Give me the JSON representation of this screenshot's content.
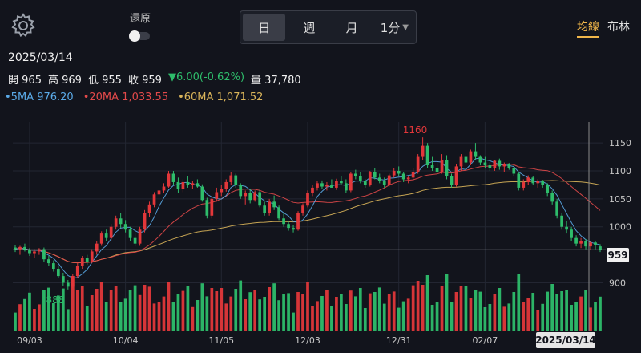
{
  "header": {
    "restore_label": "還原",
    "periods": [
      "日",
      "週",
      "月"
    ],
    "minute_label": "1分",
    "indicator_tabs": [
      "均線",
      "布林"
    ]
  },
  "quote": {
    "date": "2025/03/14",
    "open_label": "開",
    "open": "965",
    "high_label": "高",
    "high": "969",
    "low_label": "低",
    "low": "955",
    "close_label": "收",
    "close": "959",
    "change": "6.00(-0.62%)",
    "volume_label": "量",
    "volume": "37,780"
  },
  "ma": {
    "ma5_label": "5MA",
    "ma5": "976.20",
    "ma20_label": "20MA",
    "ma20": "1,033.55",
    "ma60_label": "60MA",
    "ma60": "1,071.52"
  },
  "colors": {
    "up": "#e2373a",
    "down": "#2ebd6b",
    "ma5": "#5aa9e6",
    "ma20": "#e2494a",
    "ma60": "#d9b45a"
  },
  "chart_data": {
    "type": "candlestick",
    "y_ticks": [
      900,
      1000,
      1050,
      1100,
      1150
    ],
    "ylim": [
      872,
      1176
    ],
    "x_ticks": [
      "09/03",
      "10/04",
      "11/05",
      "12/03",
      "12/31",
      "02/07"
    ],
    "current_price": "959",
    "cursor_date": "2025/03/14",
    "high_annotation": "1160",
    "low_annotation": "888",
    "grid": true,
    "candles": [
      {
        "o": 963,
        "h": 968,
        "l": 955,
        "c": 960
      },
      {
        "o": 960,
        "h": 966,
        "l": 950,
        "c": 964
      },
      {
        "o": 964,
        "h": 970,
        "l": 956,
        "c": 958
      },
      {
        "o": 958,
        "h": 962,
        "l": 948,
        "c": 953
      },
      {
        "o": 953,
        "h": 960,
        "l": 945,
        "c": 956
      },
      {
        "o": 956,
        "h": 962,
        "l": 950,
        "c": 960
      },
      {
        "o": 960,
        "h": 963,
        "l": 938,
        "c": 942
      },
      {
        "o": 942,
        "h": 948,
        "l": 930,
        "c": 935
      },
      {
        "o": 935,
        "h": 940,
        "l": 920,
        "c": 925
      },
      {
        "o": 925,
        "h": 930,
        "l": 908,
        "c": 912
      },
      {
        "o": 912,
        "h": 918,
        "l": 895,
        "c": 900
      },
      {
        "o": 900,
        "h": 905,
        "l": 888,
        "c": 893
      },
      {
        "o": 893,
        "h": 915,
        "l": 890,
        "c": 912
      },
      {
        "o": 912,
        "h": 935,
        "l": 908,
        "c": 930
      },
      {
        "o": 930,
        "h": 948,
        "l": 925,
        "c": 945
      },
      {
        "o": 945,
        "h": 950,
        "l": 932,
        "c": 938
      },
      {
        "o": 938,
        "h": 960,
        "l": 935,
        "c": 956
      },
      {
        "o": 956,
        "h": 975,
        "l": 950,
        "c": 970
      },
      {
        "o": 970,
        "h": 992,
        "l": 966,
        "c": 988
      },
      {
        "o": 988,
        "h": 995,
        "l": 975,
        "c": 980
      },
      {
        "o": 980,
        "h": 1005,
        "l": 976,
        "c": 1000
      },
      {
        "o": 1000,
        "h": 1020,
        "l": 995,
        "c": 1015
      },
      {
        "o": 1015,
        "h": 1025,
        "l": 998,
        "c": 1005
      },
      {
        "o": 1005,
        "h": 1012,
        "l": 990,
        "c": 995
      },
      {
        "o": 995,
        "h": 1000,
        "l": 975,
        "c": 980
      },
      {
        "o": 980,
        "h": 988,
        "l": 965,
        "c": 970
      },
      {
        "o": 970,
        "h": 1000,
        "l": 966,
        "c": 995
      },
      {
        "o": 995,
        "h": 1030,
        "l": 990,
        "c": 1025
      },
      {
        "o": 1025,
        "h": 1045,
        "l": 1018,
        "c": 1040
      },
      {
        "o": 1040,
        "h": 1062,
        "l": 1035,
        "c": 1058
      },
      {
        "o": 1058,
        "h": 1070,
        "l": 1050,
        "c": 1065
      },
      {
        "o": 1065,
        "h": 1078,
        "l": 1060,
        "c": 1072
      },
      {
        "o": 1072,
        "h": 1100,
        "l": 1070,
        "c": 1095
      },
      {
        "o": 1095,
        "h": 1100,
        "l": 1075,
        "c": 1080
      },
      {
        "o": 1080,
        "h": 1088,
        "l": 1060,
        "c": 1068
      },
      {
        "o": 1068,
        "h": 1085,
        "l": 1062,
        "c": 1080
      },
      {
        "o": 1080,
        "h": 1090,
        "l": 1070,
        "c": 1075
      },
      {
        "o": 1075,
        "h": 1082,
        "l": 1068,
        "c": 1078
      },
      {
        "o": 1078,
        "h": 1085,
        "l": 1070,
        "c": 1072
      },
      {
        "o": 1072,
        "h": 1076,
        "l": 1045,
        "c": 1048
      },
      {
        "o": 1048,
        "h": 1052,
        "l": 1015,
        "c": 1020
      },
      {
        "o": 1020,
        "h": 1055,
        "l": 1015,
        "c": 1050
      },
      {
        "o": 1050,
        "h": 1070,
        "l": 1045,
        "c": 1062
      },
      {
        "o": 1062,
        "h": 1075,
        "l": 1055,
        "c": 1068
      },
      {
        "o": 1068,
        "h": 1085,
        "l": 1063,
        "c": 1080
      },
      {
        "o": 1080,
        "h": 1098,
        "l": 1075,
        "c": 1092
      },
      {
        "o": 1092,
        "h": 1095,
        "l": 1070,
        "c": 1075
      },
      {
        "o": 1075,
        "h": 1078,
        "l": 1050,
        "c": 1055
      },
      {
        "o": 1055,
        "h": 1065,
        "l": 1040,
        "c": 1060
      },
      {
        "o": 1060,
        "h": 1068,
        "l": 1042,
        "c": 1048
      },
      {
        "o": 1048,
        "h": 1065,
        "l": 1045,
        "c": 1062
      },
      {
        "o": 1062,
        "h": 1066,
        "l": 1035,
        "c": 1038
      },
      {
        "o": 1038,
        "h": 1045,
        "l": 1020,
        "c": 1025
      },
      {
        "o": 1025,
        "h": 1050,
        "l": 1020,
        "c": 1045
      },
      {
        "o": 1045,
        "h": 1056,
        "l": 1030,
        "c": 1035
      },
      {
        "o": 1035,
        "h": 1038,
        "l": 1012,
        "c": 1015
      },
      {
        "o": 1015,
        "h": 1025,
        "l": 1000,
        "c": 1005
      },
      {
        "o": 1005,
        "h": 1010,
        "l": 993,
        "c": 998
      },
      {
        "o": 998,
        "h": 1003,
        "l": 990,
        "c": 995
      },
      {
        "o": 995,
        "h": 1028,
        "l": 993,
        "c": 1025
      },
      {
        "o": 1025,
        "h": 1042,
        "l": 1020,
        "c": 1038
      },
      {
        "o": 1038,
        "h": 1065,
        "l": 1035,
        "c": 1060
      },
      {
        "o": 1060,
        "h": 1075,
        "l": 1055,
        "c": 1070
      },
      {
        "o": 1070,
        "h": 1082,
        "l": 1065,
        "c": 1078
      },
      {
        "o": 1078,
        "h": 1083,
        "l": 1068,
        "c": 1072
      },
      {
        "o": 1072,
        "h": 1080,
        "l": 1065,
        "c": 1075
      },
      {
        "o": 1075,
        "h": 1085,
        "l": 1070,
        "c": 1070
      },
      {
        "o": 1070,
        "h": 1086,
        "l": 1066,
        "c": 1082
      },
      {
        "o": 1082,
        "h": 1090,
        "l": 1075,
        "c": 1078
      },
      {
        "o": 1078,
        "h": 1085,
        "l": 1060,
        "c": 1065
      },
      {
        "o": 1065,
        "h": 1098,
        "l": 1062,
        "c": 1095
      },
      {
        "o": 1095,
        "h": 1102,
        "l": 1085,
        "c": 1090
      },
      {
        "o": 1090,
        "h": 1098,
        "l": 1078,
        "c": 1082
      },
      {
        "o": 1082,
        "h": 1085,
        "l": 1070,
        "c": 1075
      },
      {
        "o": 1075,
        "h": 1100,
        "l": 1072,
        "c": 1098
      },
      {
        "o": 1098,
        "h": 1105,
        "l": 1085,
        "c": 1088
      },
      {
        "o": 1088,
        "h": 1095,
        "l": 1078,
        "c": 1082
      },
      {
        "o": 1082,
        "h": 1088,
        "l": 1070,
        "c": 1075
      },
      {
        "o": 1075,
        "h": 1095,
        "l": 1072,
        "c": 1092
      },
      {
        "o": 1092,
        "h": 1105,
        "l": 1088,
        "c": 1100
      },
      {
        "o": 1100,
        "h": 1108,
        "l": 1090,
        "c": 1095
      },
      {
        "o": 1095,
        "h": 1098,
        "l": 1080,
        "c": 1085
      },
      {
        "o": 1085,
        "h": 1090,
        "l": 1078,
        "c": 1088
      },
      {
        "o": 1088,
        "h": 1105,
        "l": 1082,
        "c": 1098
      },
      {
        "o": 1098,
        "h": 1130,
        "l": 1095,
        "c": 1125
      },
      {
        "o": 1125,
        "h": 1160,
        "l": 1120,
        "c": 1145
      },
      {
        "o": 1145,
        "h": 1150,
        "l": 1105,
        "c": 1110
      },
      {
        "o": 1110,
        "h": 1125,
        "l": 1100,
        "c": 1105
      },
      {
        "o": 1105,
        "h": 1115,
        "l": 1095,
        "c": 1098
      },
      {
        "o": 1098,
        "h": 1130,
        "l": 1095,
        "c": 1120
      },
      {
        "o": 1120,
        "h": 1128,
        "l": 1085,
        "c": 1090
      },
      {
        "o": 1090,
        "h": 1095,
        "l": 1070,
        "c": 1075
      },
      {
        "o": 1075,
        "h": 1112,
        "l": 1072,
        "c": 1108
      },
      {
        "o": 1108,
        "h": 1130,
        "l": 1100,
        "c": 1125
      },
      {
        "o": 1125,
        "h": 1130,
        "l": 1110,
        "c": 1115
      },
      {
        "o": 1115,
        "h": 1138,
        "l": 1110,
        "c": 1135
      },
      {
        "o": 1135,
        "h": 1150,
        "l": 1120,
        "c": 1125
      },
      {
        "o": 1125,
        "h": 1128,
        "l": 1110,
        "c": 1115
      },
      {
        "o": 1115,
        "h": 1125,
        "l": 1105,
        "c": 1110
      },
      {
        "o": 1110,
        "h": 1115,
        "l": 1100,
        "c": 1105
      },
      {
        "o": 1105,
        "h": 1120,
        "l": 1100,
        "c": 1118
      },
      {
        "o": 1118,
        "h": 1122,
        "l": 1102,
        "c": 1108
      },
      {
        "o": 1108,
        "h": 1115,
        "l": 1098,
        "c": 1112
      },
      {
        "o": 1112,
        "h": 1114,
        "l": 1102,
        "c": 1105
      },
      {
        "o": 1105,
        "h": 1110,
        "l": 1090,
        "c": 1095
      },
      {
        "o": 1095,
        "h": 1098,
        "l": 1065,
        "c": 1070
      },
      {
        "o": 1070,
        "h": 1085,
        "l": 1065,
        "c": 1080
      },
      {
        "o": 1080,
        "h": 1092,
        "l": 1075,
        "c": 1088
      },
      {
        "o": 1088,
        "h": 1090,
        "l": 1075,
        "c": 1078
      },
      {
        "o": 1078,
        "h": 1085,
        "l": 1070,
        "c": 1082
      },
      {
        "o": 1082,
        "h": 1084,
        "l": 1070,
        "c": 1075
      },
      {
        "o": 1075,
        "h": 1078,
        "l": 1055,
        "c": 1060
      },
      {
        "o": 1060,
        "h": 1065,
        "l": 1040,
        "c": 1045
      },
      {
        "o": 1045,
        "h": 1050,
        "l": 1015,
        "c": 1020
      },
      {
        "o": 1020,
        "h": 1025,
        "l": 995,
        "c": 1000
      },
      {
        "o": 1000,
        "h": 1010,
        "l": 988,
        "c": 995
      },
      {
        "o": 995,
        "h": 1000,
        "l": 975,
        "c": 980
      },
      {
        "o": 980,
        "h": 985,
        "l": 965,
        "c": 970
      },
      {
        "o": 970,
        "h": 980,
        "l": 962,
        "c": 975
      },
      {
        "o": 975,
        "h": 978,
        "l": 960,
        "c": 965
      },
      {
        "o": 965,
        "h": 975,
        "l": 958,
        "c": 972
      },
      {
        "o": 972,
        "h": 975,
        "l": 960,
        "c": 968
      },
      {
        "o": 965,
        "h": 969,
        "l": 955,
        "c": 959
      }
    ]
  }
}
